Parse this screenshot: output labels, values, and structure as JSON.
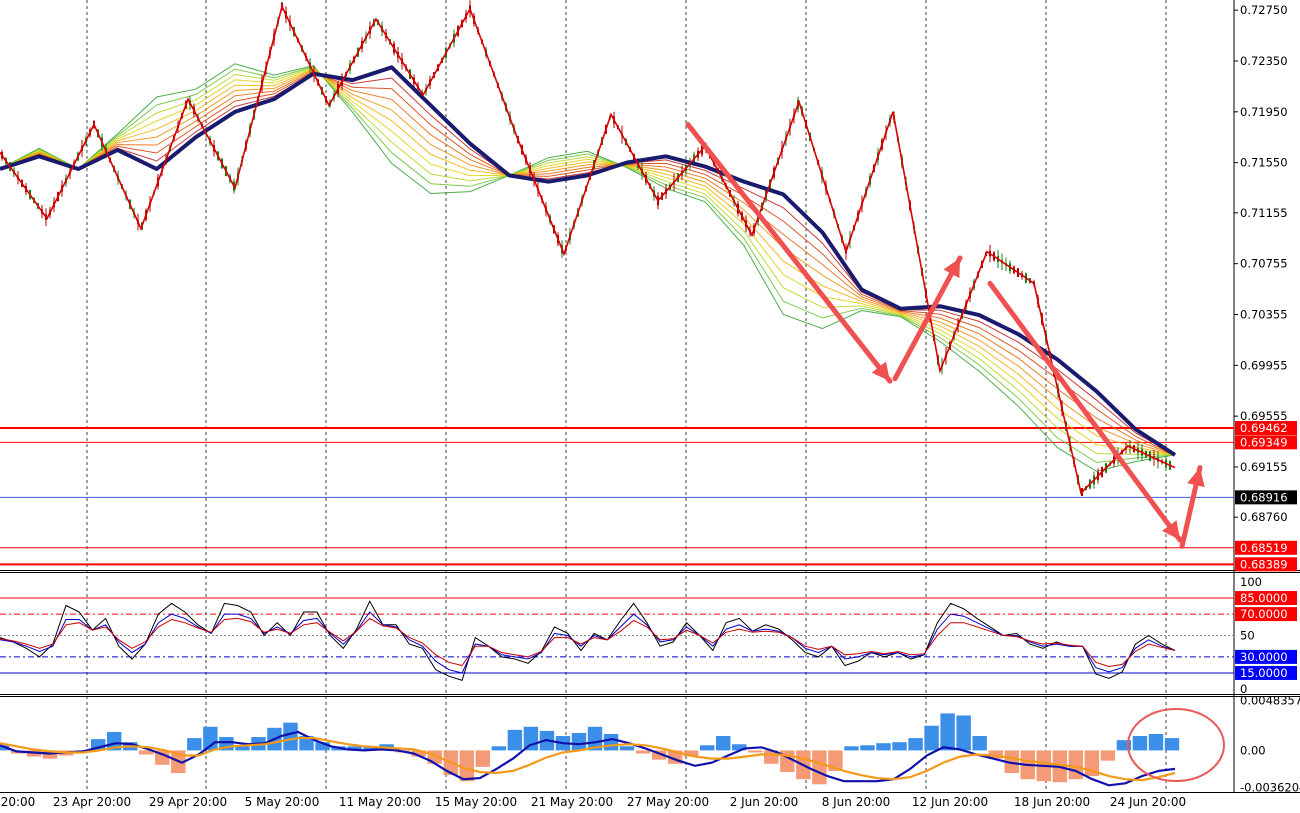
{
  "chart_data": [
    {
      "type": "line",
      "panel": "main",
      "ylim": [
        0.6836,
        0.7283
      ],
      "y_ticks": [
        "0.72750",
        "0.72350",
        "0.71950",
        "0.71550",
        "0.71155",
        "0.70755",
        "0.70355",
        "0.69955",
        "0.69555",
        "0.69155",
        "0.68760"
      ],
      "x_ticks": [
        "20:00",
        "23 Apr 20:00",
        "29 Apr 20:00",
        "5 May 20:00",
        "11 May 20:00",
        "15 May 20:00",
        "21 May 20:00",
        "27 May 20:00",
        "2 Jun 20:00",
        "8 Jun 20:00",
        "12 Jun 20:00",
        "18 Jun 20:00",
        "24 Jun 20:00"
      ],
      "levels": [
        {
          "label": "0.69462",
          "value": 0.69462,
          "color": "#ff0000",
          "bold": true
        },
        {
          "label": "0.69349",
          "value": 0.69349,
          "color": "#ff0000",
          "bold": false
        },
        {
          "label": "0.68916",
          "value": 0.68916,
          "color": "#000000",
          "bold": false,
          "current": true
        },
        {
          "label": "0.68519",
          "value": 0.68519,
          "color": "#ff0000",
          "bold": false
        },
        {
          "label": "0.68389",
          "value": 0.68389,
          "color": "#ff0000",
          "bold": true
        }
      ],
      "series": [
        {
          "role": "price-zigzag",
          "color": "#dd0000",
          "values": [
            0.7163,
            0.7111,
            0.7185,
            0.7103,
            0.7205,
            0.7135,
            0.7278,
            0.72,
            0.7268,
            0.7208,
            0.7276,
            0.7175,
            0.7083,
            0.7193,
            0.7125,
            0.7168,
            0.7098,
            0.7203,
            0.7085,
            0.7195,
            0.6991,
            0.7085,
            0.706,
            0.6895,
            0.6932,
            0.6915
          ]
        },
        {
          "role": "slow-moving-average",
          "color": "#1a1a6e",
          "values": [
            0.715,
            0.716,
            0.715,
            0.7165,
            0.715,
            0.7175,
            0.7195,
            0.7205,
            0.7225,
            0.722,
            0.723,
            0.72,
            0.717,
            0.7145,
            0.714,
            0.7145,
            0.7155,
            0.716,
            0.7152,
            0.714,
            0.713,
            0.71,
            0.7055,
            0.704,
            0.7042,
            0.7035,
            0.702,
            0.7,
            0.6975,
            0.6945,
            0.6925
          ]
        }
      ],
      "arrows": [
        {
          "from": [
            0.7185,
            "27 May 20:00"
          ],
          "to": [
            0.6983,
            "8 Jun 20:00"
          ],
          "color": "#f05050"
        },
        {
          "from": [
            0.6985,
            "8 Jun 20:00"
          ],
          "to": [
            0.708,
            "12 Jun 20:00"
          ],
          "color": "#f05050"
        },
        {
          "from": [
            0.706,
            "12 Jun 20:00"
          ],
          "to": [
            0.6858,
            "24 Jun 20:00"
          ],
          "color": "#f05050"
        },
        {
          "from": [
            0.6853,
            "24 Jun 20:00"
          ],
          "to": [
            0.6915,
            "24 Jun 20:00"
          ],
          "color": "#f05050"
        }
      ]
    },
    {
      "type": "line",
      "panel": "oscillator",
      "ylim": [
        0,
        100
      ],
      "y_ticks": [
        "100",
        "50",
        "0"
      ],
      "levels": [
        {
          "label": "85.0000",
          "value": 85,
          "color": "#ff0000",
          "bg": "#ff0000"
        },
        {
          "label": "70.0000",
          "value": 70,
          "color": "#ff0000",
          "bg": "#ff0000"
        },
        {
          "label": "30.0000",
          "value": 30,
          "color": "#0000cc",
          "bg": "#0000ff"
        },
        {
          "label": "15.0000",
          "value": 15,
          "color": "#0000cc",
          "bg": "#0000ff"
        }
      ],
      "series": [
        {
          "role": "fast",
          "color": "#000000",
          "values": [
            48,
            44,
            38,
            30,
            42,
            78,
            72,
            55,
            66,
            40,
            28,
            42,
            70,
            80,
            72,
            60,
            52,
            80,
            78,
            72,
            50,
            62,
            50,
            72,
            72,
            50,
            38,
            56,
            82,
            60,
            60,
            42,
            38,
            18,
            12,
            8,
            48,
            40,
            30,
            28,
            24,
            35,
            58,
            52,
            36,
            52,
            46,
            64,
            80,
            62,
            40,
            44,
            62,
            50,
            36,
            62,
            66,
            54,
            60,
            56,
            46,
            34,
            30,
            40,
            22,
            26,
            34,
            30,
            34,
            28,
            32,
            62,
            80,
            75,
            66,
            58,
            50,
            52,
            42,
            38,
            44,
            40,
            40,
            14,
            10,
            16,
            42,
            50,
            42,
            36
          ]
        },
        {
          "role": "mid",
          "color": "#0000cc",
          "values": [
            46,
            44,
            40,
            35,
            40,
            65,
            65,
            55,
            60,
            44,
            34,
            42,
            62,
            70,
            66,
            58,
            52,
            70,
            70,
            66,
            52,
            58,
            52,
            64,
            66,
            52,
            42,
            54,
            72,
            60,
            58,
            46,
            40,
            26,
            18,
            15,
            42,
            40,
            32,
            30,
            28,
            34,
            52,
            50,
            40,
            50,
            46,
            58,
            70,
            60,
            44,
            46,
            58,
            50,
            40,
            56,
            60,
            54,
            56,
            54,
            48,
            38,
            34,
            40,
            28,
            30,
            34,
            32,
            34,
            30,
            32,
            56,
            70,
            68,
            62,
            56,
            50,
            50,
            44,
            40,
            42,
            40,
            40,
            20,
            16,
            20,
            38,
            46,
            40,
            36
          ]
        },
        {
          "role": "slow",
          "color": "#cc0000",
          "values": [
            47,
            45,
            42,
            38,
            42,
            60,
            62,
            55,
            58,
            46,
            38,
            44,
            58,
            65,
            62,
            57,
            53,
            65,
            66,
            63,
            53,
            56,
            52,
            60,
            62,
            53,
            45,
            54,
            66,
            59,
            57,
            48,
            43,
            32,
            25,
            22,
            40,
            40,
            34,
            32,
            30,
            35,
            48,
            48,
            42,
            48,
            46,
            54,
            64,
            58,
            46,
            47,
            55,
            50,
            43,
            53,
            56,
            53,
            54,
            53,
            48,
            40,
            37,
            40,
            32,
            33,
            35,
            33,
            35,
            32,
            33,
            50,
            62,
            62,
            58,
            54,
            50,
            49,
            45,
            42,
            43,
            41,
            40,
            25,
            21,
            23,
            35,
            42,
            39,
            36
          ]
        }
      ]
    },
    {
      "type": "bar",
      "panel": "histogram",
      "ylim": [
        -0.00405,
        0.0052
      ],
      "y_ticks": [
        "0.0048357",
        "0.00",
        "-0.0036204"
      ],
      "series": [
        {
          "role": "histogram",
          "color_positive": "#3c8fe8",
          "color_negative": "#f59a76",
          "values": [
            0.0005,
            -0.0003,
            -0.0006,
            -0.0008,
            -0.0005,
            0.0,
            0.0011,
            0.0018,
            0.0008,
            -0.0004,
            -0.0014,
            -0.0022,
            0.0012,
            0.0023,
            0.0013,
            0.0004,
            0.0013,
            0.0022,
            0.0027,
            0.0014,
            0.0008,
            0.0004,
            0.0004,
            0.0003,
            0.0006,
            -0.0002,
            -0.0006,
            -0.0013,
            -0.0024,
            -0.003,
            -0.0016,
            0.0004,
            0.002,
            0.0023,
            0.0019,
            0.0014,
            0.0017,
            0.0023,
            0.0016,
            0.0004,
            -0.0003,
            -0.0009,
            -0.0013,
            -0.0006,
            0.0005,
            0.0014,
            0.0006,
            -0.0002,
            -0.0013,
            -0.0021,
            -0.0028,
            -0.0033,
            -0.002,
            0.0004,
            0.0005,
            0.0007,
            0.0008,
            0.0012,
            0.0024,
            0.0036,
            0.0034,
            0.0014,
            -0.0008,
            -0.0022,
            -0.0028,
            -0.003,
            -0.0031,
            -0.0028,
            -0.0025,
            -0.001,
            0.001,
            0.0014,
            0.0016,
            0.0012
          ]
        },
        {
          "role": "signal-blue",
          "color": "#1010aa",
          "values": [
            0.0005,
            -0.0001,
            -0.0002,
            -0.0003,
            -0.0002,
            -0.0001,
            0.0003,
            0.0007,
            0.0006,
            0.0001,
            -0.0005,
            -0.0012,
            -0.0004,
            0.0008,
            0.0008,
            0.0006,
            0.0007,
            0.0014,
            0.0018,
            0.001,
            0.0004,
            0.0001,
            0.0,
            0.0001,
            0.0,
            -0.0003,
            -0.001,
            -0.002,
            -0.0028,
            -0.0027,
            -0.0018,
            -0.0008,
            0.0005,
            0.001,
            0.0007,
            0.0006,
            0.0008,
            0.0011,
            0.0007,
            0.0002,
            -0.0004,
            -0.001,
            -0.0015,
            -0.0012,
            -0.0005,
            0.0002,
            0.0003,
            -0.0002,
            -0.001,
            -0.0018,
            -0.0025,
            -0.003,
            -0.003,
            -0.003,
            -0.0028,
            -0.0018,
            -0.0005,
            0.0003,
            0.0001,
            -0.0004,
            -0.0008,
            -0.0012,
            -0.0014,
            -0.0015,
            -0.0016,
            -0.002,
            -0.0028,
            -0.0034,
            -0.0032,
            -0.0025,
            -0.002,
            -0.0018
          ]
        },
        {
          "role": "signal-orange",
          "color": "#f39a1a",
          "values": [
            0.0007,
            0.0004,
            0.0001,
            -0.0001,
            -0.0002,
            -0.0002,
            0.0,
            0.0003,
            0.0004,
            0.0003,
            0.0,
            -0.0005,
            -0.0005,
            0.0001,
            0.0004,
            0.0005,
            0.0006,
            0.0009,
            0.0012,
            0.0012,
            0.0009,
            0.0006,
            0.0004,
            0.0003,
            0.0002,
            0.0001,
            -0.0003,
            -0.001,
            -0.0017,
            -0.0021,
            -0.0022,
            -0.002,
            -0.0014,
            -0.0007,
            -0.0002,
            0.0,
            0.0003,
            0.0005,
            0.0006,
            0.0005,
            0.0002,
            -0.0002,
            -0.0006,
            -0.0008,
            -0.0008,
            -0.0006,
            -0.0004,
            -0.0004,
            -0.0006,
            -0.001,
            -0.0015,
            -0.002,
            -0.0024,
            -0.0027,
            -0.0028,
            -0.0026,
            -0.002,
            -0.0012,
            -0.0006,
            -0.0004,
            -0.0005,
            -0.0007,
            -0.001,
            -0.0012,
            -0.0014,
            -0.0016,
            -0.002,
            -0.0025,
            -0.0028,
            -0.0029,
            -0.0026,
            -0.0022
          ]
        }
      ]
    }
  ]
}
